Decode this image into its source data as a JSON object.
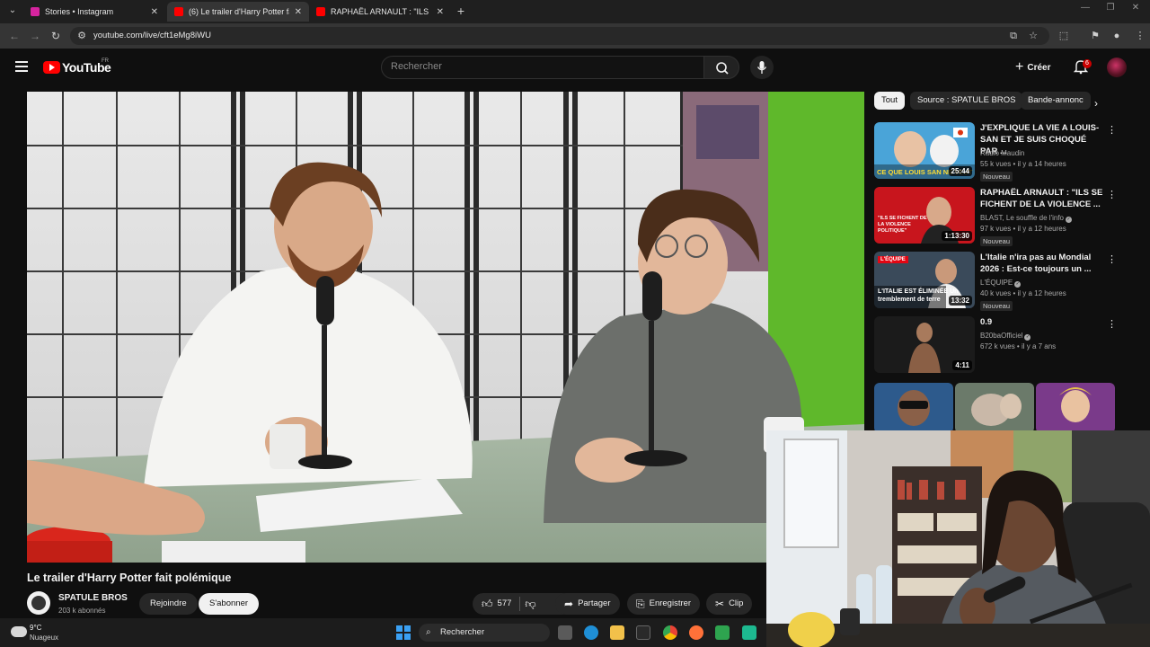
{
  "browser": {
    "tabs": [
      {
        "title": "Stories • Instagram",
        "favicon_color": "#d6249f"
      },
      {
        "title": "(6) Le trailer d'Harry Potter fait p",
        "favicon_color": "#ff0000"
      },
      {
        "title": "RAPHAËL ARNAULT : \"ILS SE FI",
        "favicon_color": "#ff0000"
      }
    ],
    "url": "youtube.com/live/cft1eMg8iWU"
  },
  "header": {
    "logo": "YouTube",
    "country": "FR",
    "search_placeholder": "Rechercher",
    "create_label": "Créer",
    "notifications": "6"
  },
  "chips": [
    "Tout",
    "Source : SPATULE BROS",
    "Bande-annonc"
  ],
  "recommendations": [
    {
      "title": "J'EXPLIQUE LA VIE A LOUIS-SAN ET JE SUIS CHOQUÉ PAR ...",
      "channel": "Radio Maudin",
      "verified": false,
      "meta": "55 k vues • il y a 14 heures",
      "badge": "Nouveau",
      "duration": "25:44",
      "thumb_text": "CE QUE LOUIS SAN NE VEUT"
    },
    {
      "title": "RAPHAËL ARNAULT : \"ILS SE FICHENT DE LA VIOLENCE ...",
      "channel": "BLAST, Le souffle de l'info",
      "verified": true,
      "meta": "97 k vues • il y a 12 heures",
      "badge": "Nouveau",
      "duration": "1:13:30",
      "thumb_text": "\"ILS SE FICHENT DE LA VIOLENCE POLITIQUE\""
    },
    {
      "title": "L'Italie n'ira pas au Mondial 2026 : Est-ce toujours un ...",
      "channel": "L'ÉQUIPE",
      "verified": true,
      "meta": "40 k vues • il y a 12 heures",
      "badge": "Nouveau",
      "duration": "13:32",
      "thumb_text": "L'ITALIE EST ÉLIMINÉE Un tremblement de terre",
      "thumb_tag": "L'ÉQUIPE"
    },
    {
      "title": "0.9",
      "channel": "B20baOfficiel",
      "verified": true,
      "meta": "672 k vues • il y a 7 ans",
      "badge": "",
      "duration": "4:11",
      "thumb_text": ""
    }
  ],
  "video": {
    "title": "Le trailer d'Harry Potter fait polémique",
    "channel": "SPATULE BROS",
    "subscribers": "203 k abonnés",
    "join_label": "Rejoindre",
    "subscribe_label": "S'abonner",
    "likes": "577",
    "share_label": "Partager",
    "save_label": "Enregistrer",
    "clip_label": "Clip"
  },
  "taskbar": {
    "temp": "9°C",
    "condition": "Nuageux",
    "search": "Rechercher"
  },
  "colors": {
    "accent": "#ff0000",
    "background": "#0f0f0f",
    "chip": "#272727"
  }
}
